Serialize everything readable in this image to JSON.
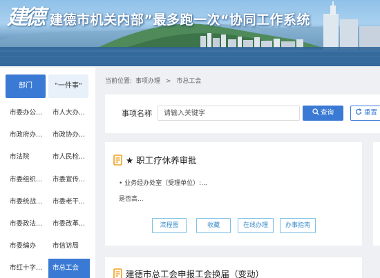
{
  "banner": {
    "logo_text": "建德",
    "title": "建德市机关内部”最多跑一次“协同工作系统"
  },
  "tabs": [
    {
      "label": "部门",
      "active": true
    },
    {
      "label": "\"一件事\"",
      "active": false
    }
  ],
  "departments": [
    {
      "label": "市委办公...",
      "active": false
    },
    {
      "label": "市人大办...",
      "active": false
    },
    {
      "label": "市政府办...",
      "active": false
    },
    {
      "label": "市政协办...",
      "active": false
    },
    {
      "label": "市法院",
      "active": false
    },
    {
      "label": "市人民检...",
      "active": false
    },
    {
      "label": "市委组织...",
      "active": false
    },
    {
      "label": "市委宣传...",
      "active": false
    },
    {
      "label": "市委统战...",
      "active": false
    },
    {
      "label": "市委老干...",
      "active": false
    },
    {
      "label": "市委政法...",
      "active": false
    },
    {
      "label": "市委改革...",
      "active": false
    },
    {
      "label": "市委编办",
      "active": false
    },
    {
      "label": "市信访局",
      "active": false
    },
    {
      "label": "市红十字...",
      "active": false
    },
    {
      "label": "市总工会",
      "active": true
    }
  ],
  "breadcrumb": {
    "prefix": "当前位置:",
    "level1": "事项办理",
    "separator": ">",
    "level2": "市总工会"
  },
  "search": {
    "label": "事项名称",
    "placeholder": "请输入关键字",
    "value": "",
    "query_button": "查询",
    "reset_button": "重置"
  },
  "cards": [
    {
      "title": "★ 职工疗休养审批",
      "office": "业务经办处室（受理单位）:...",
      "extra": "是否高...",
      "buttons": [
        "流程图",
        "收藏",
        "在线办理",
        "办事指南"
      ]
    },
    {
      "title": "建德市总工会申报工会换届（变动）"
    }
  ],
  "colors": {
    "primary": "#3a7ad4",
    "outline_button": "#7cc0e6",
    "icon_orange": "#f0a020"
  },
  "icons": {
    "search": "search-icon",
    "reset": "refresh-icon",
    "card": "document-icon"
  }
}
